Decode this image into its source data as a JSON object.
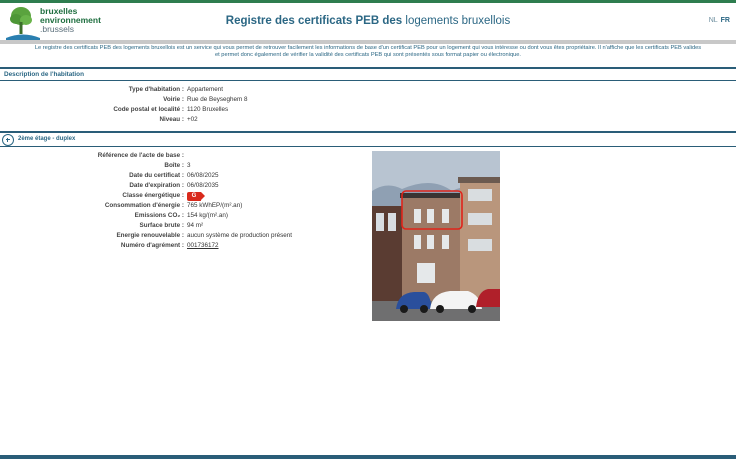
{
  "header": {
    "logo_line1": "bruxelles",
    "logo_line2": "environnement",
    "logo_line3": ".brussels",
    "title_bold": "Registre des certificats PEB des",
    "title_light": "logements bruxellois",
    "lang_nl": "NL",
    "lang_fr": "FR"
  },
  "intro": {
    "line1": "Le registre des certificats PEB des logements bruxellois est un service qui vous permet de retrouver facilement les informations de base d'un certificat PEB pour un logement qui vous intéresse ou dont vous êtes propriétaire. Il n'affiche que les certificats PEB valides",
    "line2": "et permet donc également de vérifier la validité des certificats PEB qui sont présentés sous format papier ou électronique."
  },
  "description": {
    "heading": "Description de l'habitation",
    "fields": [
      {
        "label": "Type d'habitation :",
        "value": "Appartement"
      },
      {
        "label": "Voirie :",
        "value": "Rue de Beyseghem 8"
      },
      {
        "label": "Code postal et localité :",
        "value": "1120 Bruxelles"
      },
      {
        "label": "Niveau :",
        "value": "+02"
      }
    ]
  },
  "unit": {
    "heading": "2ème étage - duplex",
    "fields": {
      "ref_label": "Référence de l'acte de base :",
      "ref_value": "",
      "boite_label": "Boîte :",
      "boite_value": "3",
      "date_cert_label": "Date du certificat :",
      "date_cert_value": "06/08/2025",
      "date_exp_label": "Date d'expiration :",
      "date_exp_value": "06/08/2035",
      "classe_label": "Classe énergétique :",
      "classe_value": "G",
      "conso_label": "Consommation d'énergie :",
      "conso_value": "765 kWhEP/(m².an)",
      "co2_label": "Emissions CO₂ :",
      "co2_value": "154 kg/(m².an)",
      "surface_label": "Surface brute :",
      "surface_value": "94 m²",
      "energie_label": "Energie renouvelable :",
      "energie_value": "aucun système de production présent",
      "agrement_label": "Numéro d'agrément :",
      "agrement_value": "001736172"
    }
  },
  "colors": {
    "brand_green": "#2e7d4f",
    "title_blue": "#2b6784",
    "energy_class_g": "#d92a1c"
  }
}
